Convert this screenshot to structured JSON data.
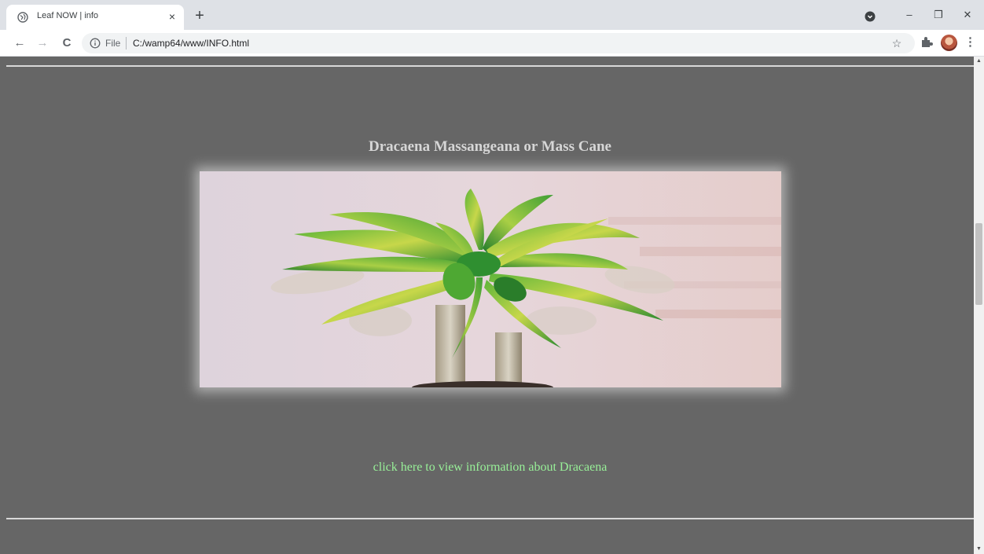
{
  "browser": {
    "tab": {
      "title": "Leaf NOW | info",
      "close_glyph": "×",
      "favicon": "globe-icon"
    },
    "new_tab_glyph": "+",
    "window_controls": {
      "minimize": "–",
      "restore": "❐",
      "close": "✕"
    },
    "toolbar": {
      "back_glyph": "←",
      "forward_glyph": "→",
      "reload_glyph": "C",
      "scheme_label": "File",
      "url": "C:/wamp64/www/INFO.html",
      "bookmark_glyph": "☆",
      "menu_glyph": "⋮"
    },
    "icons": [
      "globe-icon",
      "tab-search-icon",
      "info-icon",
      "star-icon",
      "puzzle-extension-icon",
      "profile-avatar",
      "kebab-menu-icon"
    ]
  },
  "page": {
    "plant_title": "Dracaena Massangeana or Mass Cane",
    "plant_link_text": "click here to view information about Dracaena",
    "colors": {
      "background": "#666666",
      "title": "#d6d6d6",
      "link": "#98f098",
      "rule": "#d9d9d9"
    }
  },
  "scrollbar": {
    "up_glyph": "▲",
    "down_glyph": "▼"
  }
}
